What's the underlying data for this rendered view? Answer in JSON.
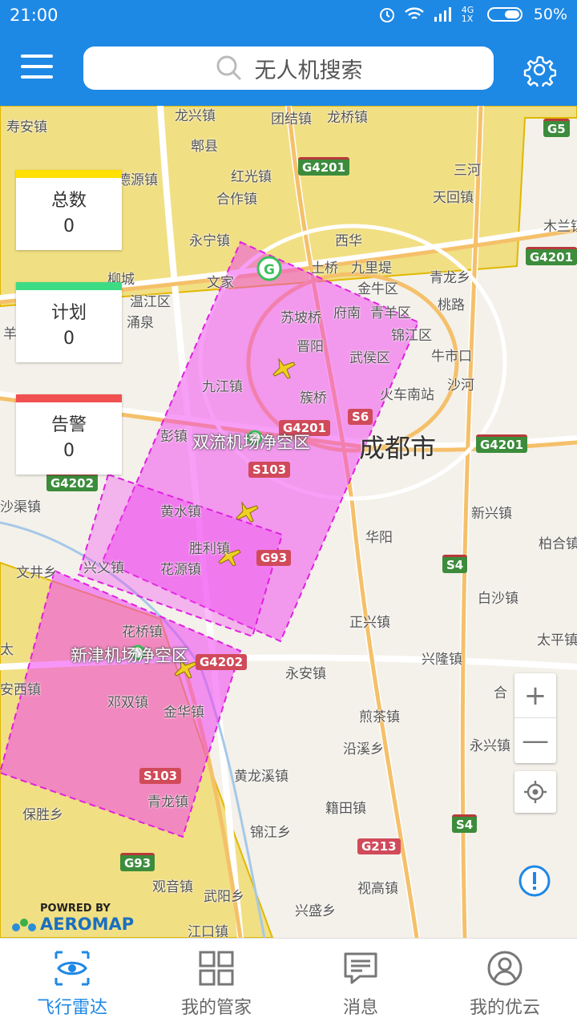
{
  "status_bar": {
    "time": "21:00",
    "network": "4G 1X",
    "battery": "50%"
  },
  "header": {
    "search_placeholder": "无人机搜索"
  },
  "stats": [
    {
      "label": "总数",
      "value": "0",
      "color": "#ffe000"
    },
    {
      "label": "计划",
      "value": "0",
      "color": "#3ddc84"
    },
    {
      "label": "告警",
      "value": "0",
      "color": "#f05050"
    }
  ],
  "map": {
    "city": "成都市",
    "zones": [
      "双流机场净空区",
      "新津机场净空区"
    ],
    "places": [
      "寿安镇",
      "龙兴镇",
      "团结镇",
      "龙桥镇",
      "郫县",
      "红光镇",
      "德源镇",
      "合作镇",
      "三河",
      "天回镇",
      "永宁镇",
      "西华",
      "木兰镇",
      "土桥",
      "九里堤",
      "柳城",
      "文家",
      "金牛区",
      "青龙乡",
      "温江区",
      "苏坡桥",
      "府南",
      "青羊区",
      "锦江区",
      "桃路",
      "涌泉",
      "晋阳",
      "武侯区",
      "牛市口",
      "九江镇",
      "簇桥",
      "火车南站",
      "沙河",
      "彭镇",
      "新兴镇",
      "黄水镇",
      "柏合镇",
      "华阳",
      "胜利镇",
      "文井乡",
      "兴义镇",
      "花源镇",
      "白沙镇",
      "正兴镇",
      "太平镇",
      "花桥镇",
      "兴隆镇",
      "永安镇",
      "邓双镇",
      "金华镇",
      "煎茶镇",
      "沿溪乡",
      "永兴镇",
      "黄龙溪镇",
      "保胜乡",
      "青龙镇",
      "锦江乡",
      "籍田镇",
      "观音镇",
      "武阳乡",
      "视高镇",
      "兴盛乡",
      "江口镇",
      "羊",
      "沙渠镇",
      "太",
      "安西镇",
      "合"
    ],
    "road_signs": [
      "G5",
      "G4201",
      "G4201",
      "G4201",
      "G4201",
      "S6",
      "S103",
      "G93",
      "G4202",
      "G4202",
      "S4",
      "S4",
      "S103",
      "G213",
      "G93"
    ],
    "attribution_top": "POWRED BY",
    "attribution_brand": "AEROMAP"
  },
  "tabs": [
    {
      "label": "飞行雷达",
      "icon": "eye-icon",
      "active": true
    },
    {
      "label": "我的管家",
      "icon": "grid-icon",
      "active": false
    },
    {
      "label": "消息",
      "icon": "message-icon",
      "active": false
    },
    {
      "label": "我的优云",
      "icon": "user-icon",
      "active": false
    }
  ],
  "colors": {
    "primary": "#1e88e5",
    "zone_fill": "#f040f0",
    "restricted_yellow": "#f0d860"
  }
}
